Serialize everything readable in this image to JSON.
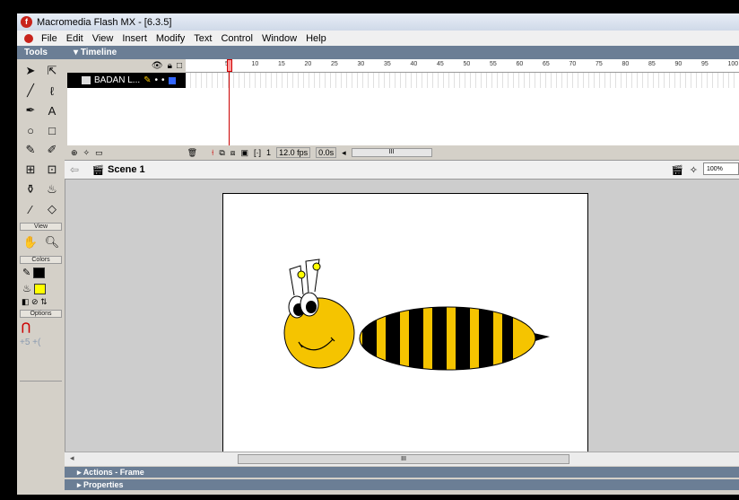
{
  "window": {
    "title": "Macromedia Flash MX - [6.3.5]"
  },
  "menu": [
    "File",
    "Edit",
    "View",
    "Insert",
    "Modify",
    "Text",
    "Control",
    "Window",
    "Help"
  ],
  "tools": {
    "header": "Tools",
    "view_label": "View",
    "colors_label": "Colors",
    "options_label": "Options",
    "stroke_color": "#000000",
    "fill_color": "#ffff00"
  },
  "timeline": {
    "header": "Timeline",
    "layer_name": "BADAN L...",
    "ruler_ticks": [
      "5",
      "10",
      "15",
      "20",
      "25",
      "30",
      "35",
      "40",
      "45",
      "50",
      "55",
      "60",
      "65",
      "70",
      "75",
      "80",
      "85",
      "90",
      "95",
      "100"
    ],
    "current_frame": "1",
    "frame_rate": "12.0 fps",
    "elapsed": "0.0s",
    "scroll_glyph": "III"
  },
  "editbar": {
    "scene": "Scene 1",
    "zoom": "100%"
  },
  "hscroll_glyph": "III",
  "panels": {
    "actions": "Actions - Frame",
    "properties": "Properties"
  },
  "colors": {
    "bee_body_yellow": "#f5c400",
    "bee_stripe": "#000000",
    "panel_header": "#6b7e95"
  }
}
